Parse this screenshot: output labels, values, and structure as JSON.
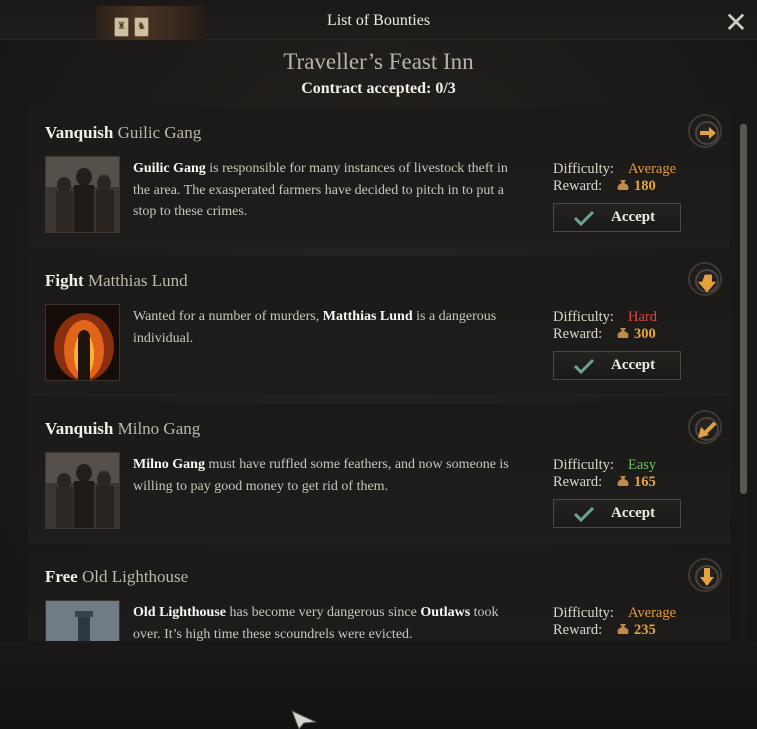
{
  "window": {
    "title": "List of Bounties",
    "close_glyph": "✕"
  },
  "header": {
    "inn_name": "Traveller’s Feast Inn",
    "contract_status": "Contract accepted: 0/3"
  },
  "labels": {
    "difficulty": "Difficulty:",
    "reward": "Reward:",
    "accept": "Accept"
  },
  "colors": {
    "average": "#e79a3c",
    "hard": "#e0453a",
    "easy": "#6cc35e",
    "reward": "#e8a53a"
  },
  "bounties": [
    {
      "verb": "Vanquish",
      "target": "Guilic Gang",
      "desc_bold": "Guilic Gang",
      "desc_rest": " is responsible for many instances of livestock theft in the area. The exasperated farmers have decided to pitch in to put a stop to these crimes.",
      "difficulty": "Average",
      "reward": "180",
      "icon": "arrow-right-compass-icon"
    },
    {
      "verb": "Fight",
      "target": "Matthias Lund",
      "desc_pre": "Wanted for a number of murders, ",
      "desc_bold": "Matthias Lund",
      "desc_rest": " is a dangerous individual.",
      "difficulty": "Hard",
      "reward": "300",
      "icon": "arrow-down-right-compass-icon"
    },
    {
      "verb": "Vanquish",
      "target": "Milno Gang",
      "desc_bold": "Milno Gang",
      "desc_rest": " must have ruffled some feathers, and now someone is willing to pay good money to get rid of them.",
      "difficulty": "Easy",
      "reward": "165",
      "icon": "arrow-down-left-compass-icon"
    },
    {
      "verb": "Free",
      "target": "Old Lighthouse",
      "desc_bold": "Old Lighthouse",
      "desc_mid": " has become very dangerous since ",
      "desc_bold2": "Outlaws",
      "desc_rest": " took over. It’s high time these scoundrels were evicted.",
      "difficulty": "Average",
      "reward": "235",
      "icon": "arrow-down-compass-icon"
    }
  ]
}
